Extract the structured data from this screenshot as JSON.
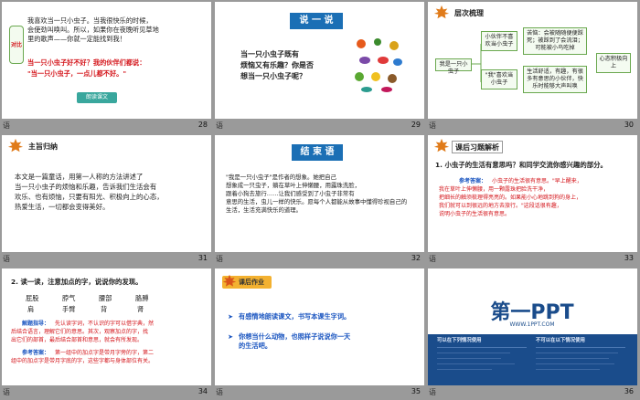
{
  "slides": [
    {
      "num": "28",
      "lines": [
        "我喜欢当一只小虫子。当我很快乐的时候，",
        "会使劲叫唤叫。所以，如果你在夜晚听见草地",
        "里的歌声——你就一定能找到我！"
      ],
      "q1": "当一只小虫子好不好？我的伙伴们都说：",
      "q2": "\"当一只小虫子，一点儿都不好。\"",
      "btn": "朗读课文",
      "side_label": "对比",
      "caption": "语"
    },
    {
      "num": "29",
      "tag": "说 一 说",
      "q": [
        "当一只小虫子既有",
        "烦恼又有乐趣？你是否",
        "想当一只小虫子呢？"
      ],
      "caption": "语"
    },
    {
      "num": "30",
      "title": "层次梳理",
      "root": "我是一只小虫子",
      "b1": "小伙伴不喜欢当小虫子",
      "b1d": "苦恼：会被随随便便踩死；被踩到了会流泪；可能被小鸟吃掉",
      "b2": "\"我\"喜欢当小虫子",
      "b2d": "生活舒适，有趣，有很多有意思的小伙伴，快乐时能够大声叫唤",
      "right": "心态积极向上",
      "caption": "语"
    },
    {
      "num": "31",
      "title": "主旨归纳",
      "body": [
        "本文是一篇童话，用第一人称的方法讲述了",
        "当一只小虫子的烦恼和乐趣，告诉我们生活会有",
        "欢乐、也有烦恼，只要有阳光、积极向上的心态，",
        "热爱生活，一切都会变得美好。"
      ],
      "caption": "语"
    },
    {
      "num": "32",
      "tag": "结 束 语",
      "body": [
        "\"我是一只小虫子\"是作者的想象。她把自己",
        "想象成一只虫子，躺在草叶上伸懒腰，用露珠洗脸，",
        "跟着小狗去旅行……让我们感受到了小虫子非常有",
        "意思的生活，虫儿一样的快乐。愿每个人都能从故事中懂得珍视自己的",
        "生活，生活充满快乐的道理。"
      ],
      "caption": "语"
    },
    {
      "num": "33",
      "title": "课后习题解析",
      "q": "1. 小虫子的生活有意思吗？和同学交流你感兴趣的部分。",
      "ans_label": "参考答案：",
      "ans": [
        "小虫子的生活很有意思。\"早上醒来，",
        "我在草叶上伸懒腰，用一颗露珠把脸洗干净，",
        "把细长的触须梳理得亮亮的。如果能小心地跳到狗的身上，",
        "我们就可以到很远的地方去旅行。\"这段话很有趣，",
        "说明小虫子的生活很有意思。"
      ],
      "caption": "语"
    },
    {
      "num": "34",
      "q": "2. 读一读，注意加点的字，说说你的发现。",
      "words_row1": [
        "屁股",
        "脖气",
        "腰部",
        "胳膊"
      ],
      "words_row2": [
        "肩",
        "手臂",
        "背",
        "肾"
      ],
      "note_label": "解题指导：",
      "note": [
        "先认读字词，不认识的字可以借字典，然",
        "后结合语言，理解它们的意思。其次，观察加点的字，找",
        "出它们的部首，最后结合部首和意思，就会有所发现。"
      ],
      "ans_label": "参考答案：",
      "ans": [
        "第一组中的加点字是带月字旁的字，第二",
        "组中的加点字是带月字底的字，这些字都与身体部位有关。"
      ],
      "caption": "语"
    },
    {
      "num": "35",
      "tab": "课后作业",
      "b1": "有感情地朗读课文，书写本课生字词。",
      "b2": [
        "你想当什么动物，也照样子说说你一天",
        "的生活吧。"
      ],
      "caption": "语"
    },
    {
      "num": "36",
      "logo": "第一PPT",
      "logo_url": "WWW.1PPT.COM",
      "f1": "可以在下列情况使用",
      "f2": "不可以在以下情况使用",
      "caption": "语"
    }
  ],
  "colors": {
    "accent_red": "#d4141a",
    "accent_blue": "#1a55c0",
    "orange": "#f3b130",
    "navy": "#1a4c8b"
  }
}
